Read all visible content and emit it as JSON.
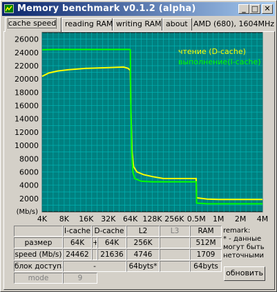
{
  "window": {
    "title": "Memory benchmark v0.1.2 (alpha)",
    "controls": {
      "minimize": "_",
      "maximize": "□",
      "close": "✕"
    }
  },
  "tabs": [
    "cache speed",
    "reading RAM",
    "writing RAM",
    "about"
  ],
  "active_tab": "cache speed",
  "cpu_info": "AMD (680), 1604MHz",
  "colors": {
    "plot_bg": "#008080",
    "grid": "#00b8b8",
    "read": "#ffff00",
    "exec": "#00ff00"
  },
  "chart_data": {
    "type": "line",
    "ylabel": "(Mb/s)",
    "ylim": [
      0,
      27000
    ],
    "yticks": [
      2000,
      4000,
      6000,
      8000,
      10000,
      12000,
      14000,
      16000,
      18000,
      20000,
      22000,
      24000,
      26000
    ],
    "xticks": [
      "4K",
      "8K",
      "16K",
      "32K",
      "64K",
      "128K",
      "256K",
      "0.5M",
      "1M",
      "2M",
      "4M"
    ],
    "legend_position": "top-right",
    "series": [
      {
        "name": "чтение  (D-cache)",
        "color": "#ffff00",
        "points": [
          [
            0,
            20400
          ],
          [
            0.3,
            20900
          ],
          [
            0.7,
            21200
          ],
          [
            1.2,
            21400
          ],
          [
            2,
            21600
          ],
          [
            3,
            21700
          ],
          [
            3.7,
            21800
          ],
          [
            3.9,
            21600
          ],
          [
            4.0,
            21300
          ],
          [
            4.03,
            15000
          ],
          [
            4.08,
            9000
          ],
          [
            4.15,
            6800
          ],
          [
            4.3,
            6000
          ],
          [
            4.6,
            5600
          ],
          [
            5,
            5300
          ],
          [
            5.5,
            5000
          ],
          [
            6,
            5000
          ],
          [
            6.99,
            5000
          ],
          [
            7.01,
            2100
          ],
          [
            7.5,
            1900
          ],
          [
            8,
            1850
          ],
          [
            10,
            1850
          ]
        ]
      },
      {
        "name": "выполнение(I-cache)",
        "color": "#00ff00",
        "points": [
          [
            0,
            24400
          ],
          [
            0.5,
            24450
          ],
          [
            2,
            24450
          ],
          [
            3,
            24450
          ],
          [
            3.95,
            24460
          ],
          [
            4.0,
            24400
          ],
          [
            4.03,
            15000
          ],
          [
            4.06,
            9000
          ],
          [
            4.12,
            6000
          ],
          [
            4.2,
            5000
          ],
          [
            4.5,
            4600
          ],
          [
            5,
            4500
          ],
          [
            6,
            4500
          ],
          [
            6.99,
            4500
          ],
          [
            7.01,
            1300
          ],
          [
            7.5,
            1200
          ],
          [
            10,
            1200
          ]
        ]
      }
    ]
  },
  "table": {
    "headers": [
      "",
      "I-cache",
      "D-cache",
      "L2",
      "L3",
      "RAM"
    ],
    "rows": [
      {
        "label": "размер",
        "icache": "64K",
        "plus": "+",
        "dcache": "64K",
        "l2": "256K",
        "l3": "",
        "ram": "512M"
      },
      {
        "label": "speed (Mb/s)",
        "icache": "24462",
        "plus": "",
        "dcache": "21636",
        "l2": "4746",
        "l3": "",
        "ram": "1709"
      },
      {
        "label": "блок доступа",
        "cache_merged": "-",
        "l2": "64byts*",
        "l3": "",
        "ram": "64byts"
      },
      {
        "label": "mode",
        "cache_merged": "9"
      }
    ]
  },
  "remark": {
    "title": "remark:",
    "text": "* - данные могут быть неточными"
  },
  "refresh_button": "обновить"
}
